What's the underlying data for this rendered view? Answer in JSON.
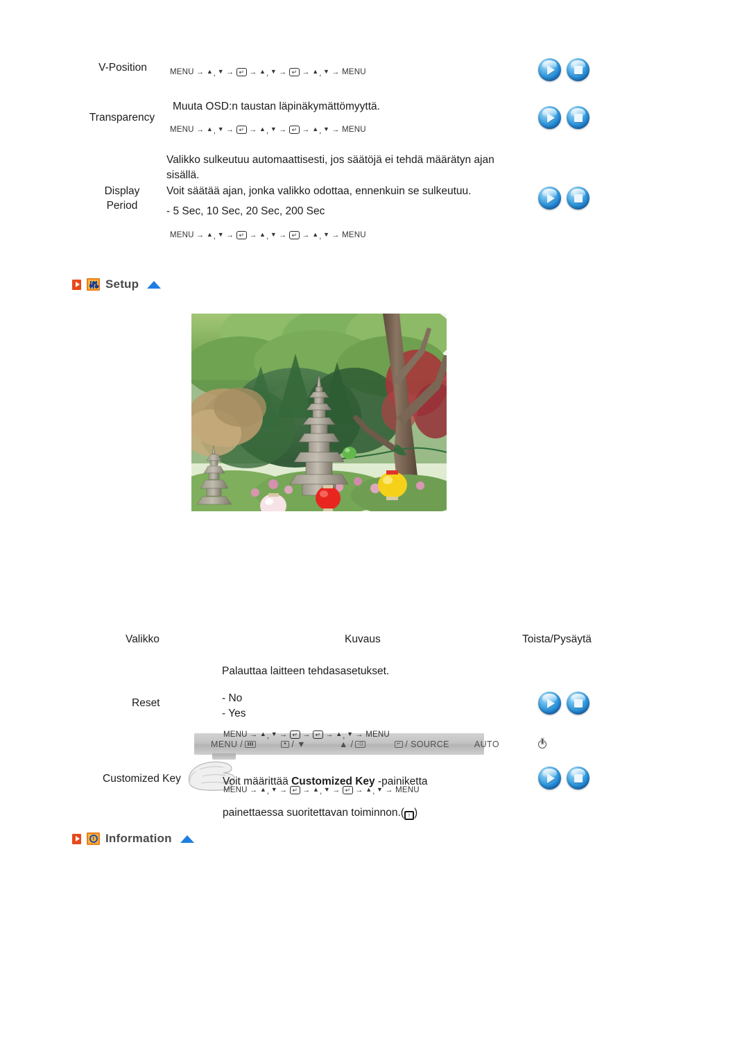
{
  "doc": {
    "language": "fi"
  },
  "osd_rows": [
    {
      "id": "v-position",
      "label": "V-Position",
      "description": "",
      "options": "",
      "nav": "MENU → ▲ , ▼ → [ENTER] → ▲ , ▼ → [ENTER] → ▲ , ▼ → MENU",
      "nav_tokens": [
        "MENU",
        "▲",
        "▼",
        "KEY",
        "▲",
        "▼",
        "KEY",
        "▲",
        "▼",
        "MENU"
      ],
      "buttons": [
        "play-button",
        "stop-button"
      ]
    },
    {
      "id": "transparency",
      "label": "Transparency",
      "description": "Muuta OSD:n taustan läpinäkymättömyyttä.",
      "options": "",
      "nav": "MENU → ▲ , ▼ → [ENTER] → ▲ , ▼ → [ENTER] → ▲ , ▼ → MENU",
      "buttons": [
        "play-button",
        "stop-button"
      ]
    },
    {
      "id": "display-period",
      "label": "Display\nPeriod",
      "description": "Valikko sulkeutuu automaattisesti, jos säätöjä ei tehdä määrätyn ajan sisällä.\nVoit säätää ajan, jonka valikko odottaa, ennenkuin se sulkeutuu.",
      "options": "- 5 Sec, 10 Sec, 20 Sec, 200 Sec",
      "nav": "MENU → ▲ , ▼ → [ENTER] → ▲ , ▼ → [ENTER] → ▲ , ▼ → MENU",
      "buttons": [
        "play-button",
        "stop-button"
      ]
    }
  ],
  "setup_section": {
    "title": "Setup",
    "icon": "equalizer-sliders-icon",
    "marker": "orange-play-marker",
    "collapse": "blue-up-triangle"
  },
  "monitor_controls": {
    "buttons": [
      {
        "id": "menu",
        "label": "MENU /",
        "glyph": "osd-panel-icon"
      },
      {
        "id": "brightness-down",
        "label": "/ ▼",
        "glyph": "brightness-icon"
      },
      {
        "id": "volume-up",
        "label": "▲ /",
        "glyph": "volume-icon"
      },
      {
        "id": "source",
        "label": "/ SOURCE",
        "glyph": "enter-icon"
      },
      {
        "id": "auto",
        "label": "AUTO",
        "glyph": ""
      },
      {
        "id": "power",
        "label": "",
        "glyph": "power-icon"
      }
    ]
  },
  "table": {
    "headers": {
      "menu": "Valikko",
      "description": "Kuvaus",
      "playstop": "Toista/Pysäytä"
    },
    "rows": [
      {
        "id": "reset",
        "label": "Reset",
        "description": "Palauttaa laitteen tehdasasetukset.",
        "options": "- No\n- Yes",
        "nav": "MENU → ▲ , ▼ → [ENTER] → [ENTER] → ▲ , ▼ → MENU",
        "buttons": [
          "play-button",
          "stop-button"
        ]
      },
      {
        "id": "customized-key",
        "label": "Customized Key",
        "description_pre": "Voit määrittää ",
        "description_bold": "Customized Key",
        "description_post": " -painiketta",
        "description_line2_pre": "painettaessa suoritettavan toiminnon.(",
        "description_line2_post": ")",
        "nav": "MENU → ▲ , ▼ → [ENTER] → ▲ , ▼ → [ENTER] → ▲ , ▼ → MENU",
        "buttons": [
          "play-button",
          "stop-button"
        ]
      }
    ]
  },
  "information_section": {
    "title": "Information",
    "icon": "clock-icon",
    "marker": "orange-play-marker",
    "collapse": "blue-up-triangle"
  },
  "glyphs": {
    "up_triangle": "▲",
    "down_triangle": "▼",
    "arrow": "→",
    "enter_key": "↵",
    "up_key": "↑",
    "menu_word": "MENU",
    "comma": ","
  },
  "colors": {
    "accent_orange": "#e8491b",
    "icon_amber": "#ffb23d",
    "blue_button": "#2e96dd",
    "collapse_blue": "#1f7fe0",
    "text": "#1c1c1c",
    "heading_gray": "#4a4a4a"
  }
}
